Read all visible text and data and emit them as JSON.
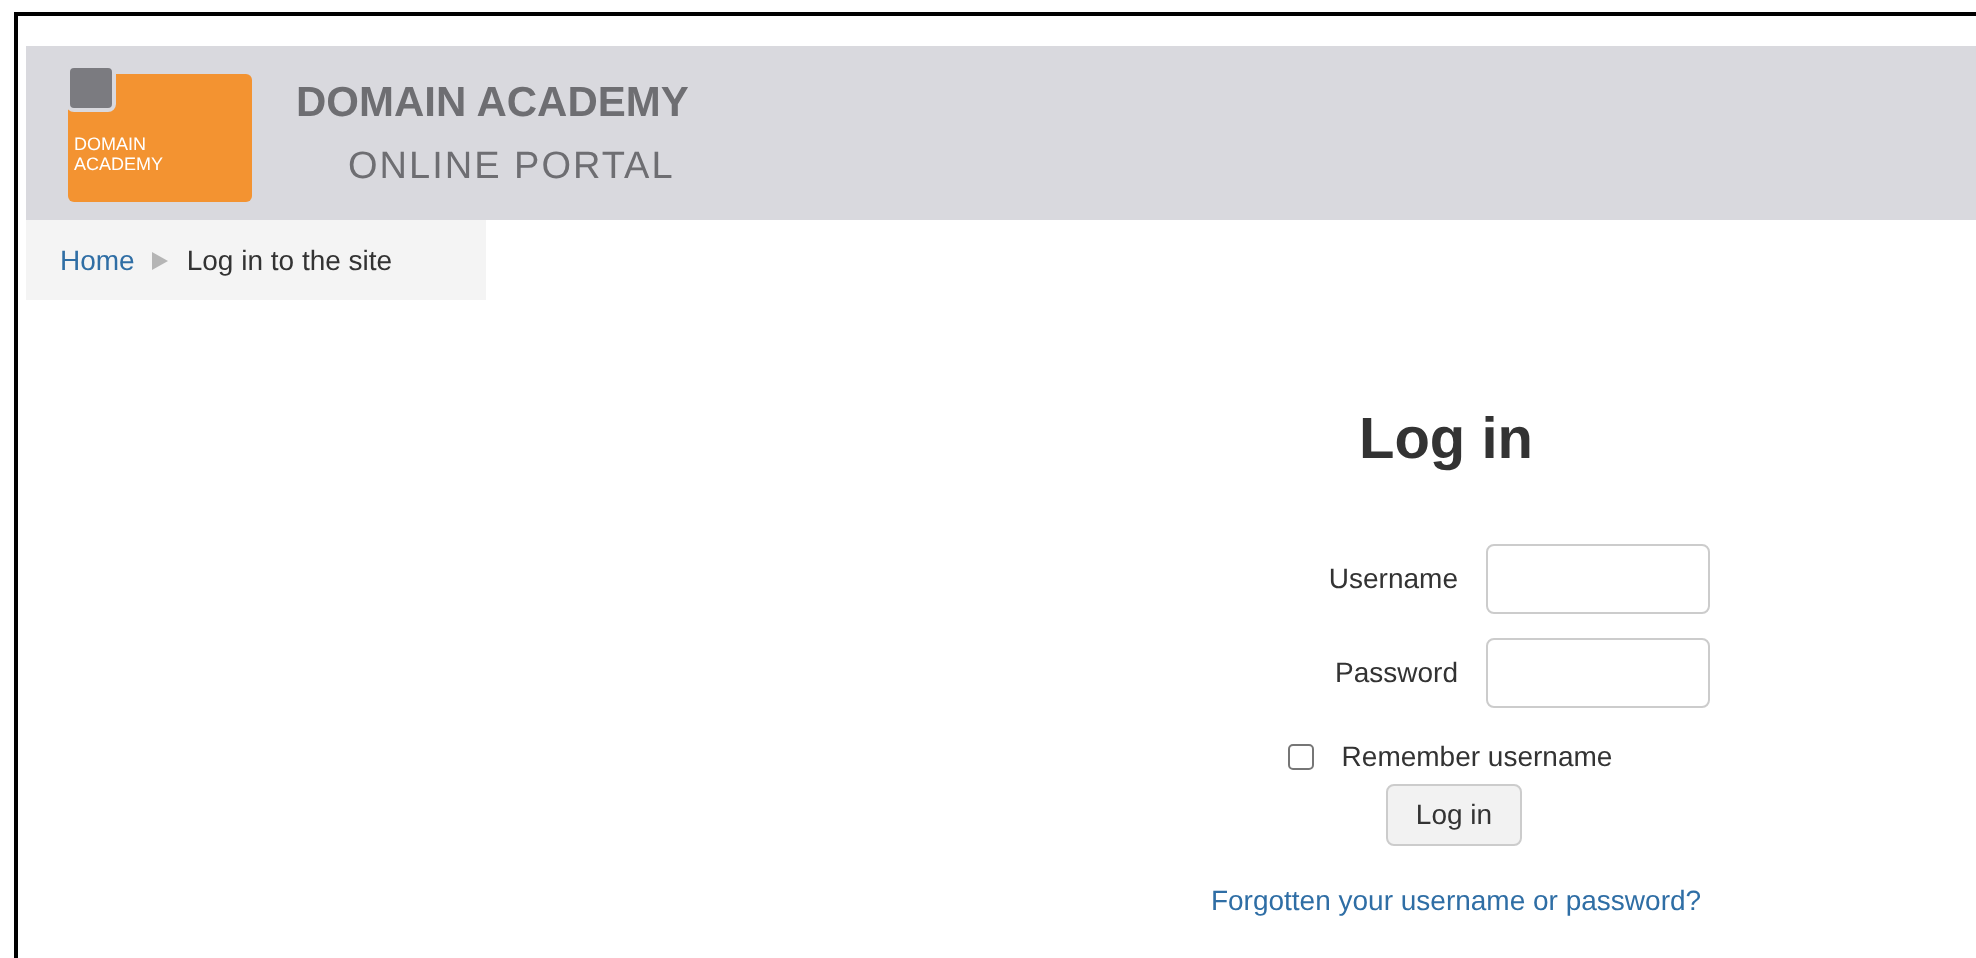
{
  "header": {
    "logo_text": [
      "DOMAIN",
      "ACADEMY"
    ],
    "title": "DOMAIN ACADEMY",
    "subtitle": "ONLINE PORTAL"
  },
  "breadcrumb": [
    {
      "label": "Home",
      "kind": "link"
    },
    {
      "label": "Log in to the site",
      "kind": "current"
    }
  ],
  "login": {
    "title": "Log in",
    "fields": [
      {
        "label": "Username"
      },
      {
        "label": "Password"
      }
    ],
    "remember": {
      "label": "Remember username",
      "checked": false
    },
    "button": "Log in",
    "forgot_link": "Forgotten your username or password?"
  }
}
